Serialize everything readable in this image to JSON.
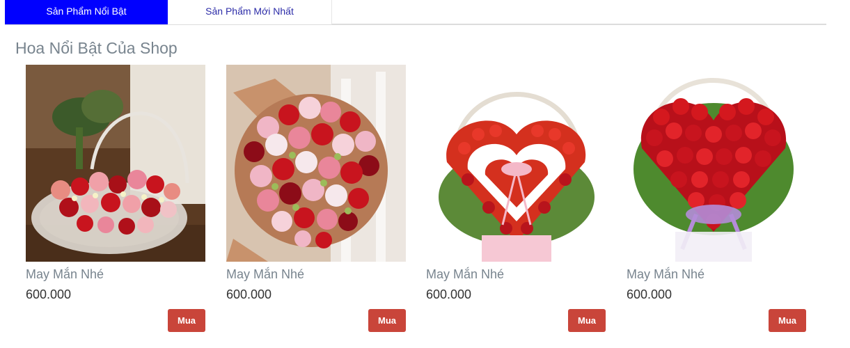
{
  "tabs": [
    {
      "label": "Sản Phẩm Nổi Bật",
      "active": true
    },
    {
      "label": "Sản Phẩm Mới Nhất",
      "active": false
    }
  ],
  "section": {
    "title": "Hoa Nổi Bật Của Shop"
  },
  "products": [
    {
      "name": "May Mắn Nhé",
      "price": "600.000",
      "buy_label": "Mua"
    },
    {
      "name": "May Mắn Nhé",
      "price": "600.000",
      "buy_label": "Mua"
    },
    {
      "name": "May Mắn Nhé",
      "price": "600.000",
      "buy_label": "Mua"
    },
    {
      "name": "May Mắn Nhé",
      "price": "600.000",
      "buy_label": "Mua"
    }
  ],
  "colors": {
    "active_tab": "#0000ff",
    "buy_button": "#c9453a",
    "rose_red": "#c8141e",
    "rose_pink": "#e9869a"
  }
}
